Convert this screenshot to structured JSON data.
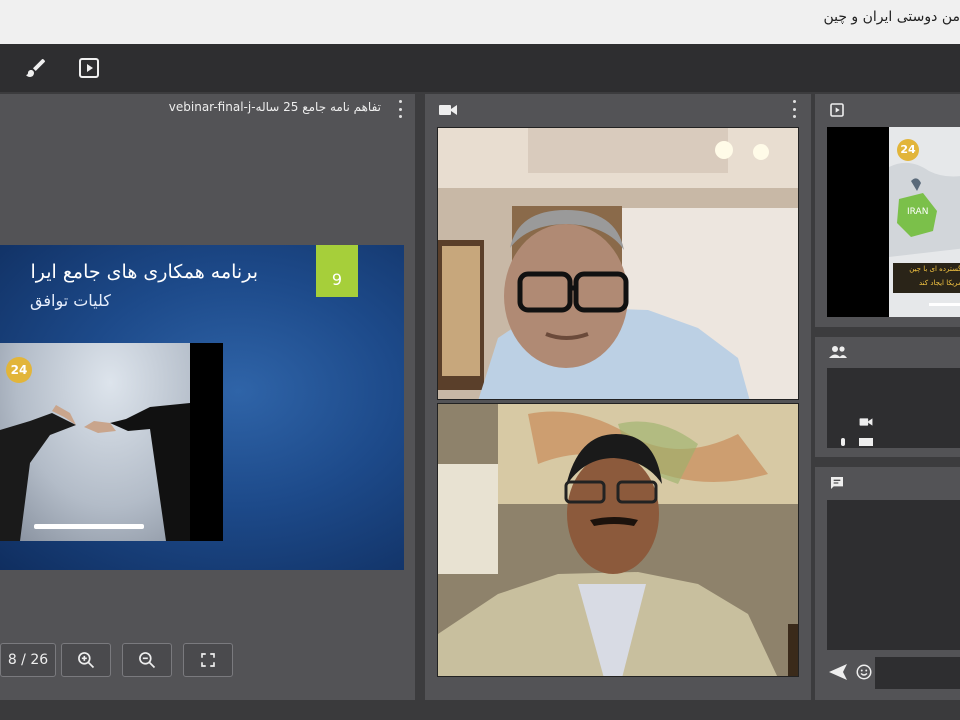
{
  "window": {
    "title": "من دوستی ایران و چین"
  },
  "toolbar": {
    "tools": [
      {
        "id": "brush",
        "icon": "brush-icon"
      },
      {
        "id": "play",
        "icon": "play-box-icon"
      }
    ]
  },
  "share_pod": {
    "document_title": "تفاهم نامه جامع 25 ساله-vebinar-final-j",
    "slide": {
      "number": "9",
      "title": "برنامه همکاری های جامع ایرا",
      "subtitle": "کلیات توافق",
      "logo_text": "24"
    },
    "controls": {
      "page_indicator": "8 / 26",
      "zoom_in_icon": "zoom-in-icon",
      "zoom_out_icon": "zoom-out-icon",
      "fullscreen_icon": "fullscreen-icon"
    }
  },
  "video_pod": {
    "header_icon": "camera-icon",
    "participants": [
      {
        "id": "video-1",
        "desc": "participant-1"
      },
      {
        "id": "video-2",
        "desc": "participant-2"
      }
    ]
  },
  "share_mini": {
    "header_icon": "play-box-icon",
    "logo_text": "24",
    "map_label": "IRAN",
    "caption_line1": "بلاد گسترده ای با چین",
    "caption_line2": "آل آمریکا ایجاد کند"
  },
  "attendees_pod": {
    "header_icon": "people-icon"
  },
  "chat_pod": {
    "header_icon": "chat-icon",
    "send_icon": "send-icon",
    "emoji_icon": "emoji-icon"
  },
  "colors": {
    "pod_bg": "#535356",
    "toolbar_bg": "#2e2e30",
    "slide_accent": "#a6cf3a",
    "slide_bg": "#1d4a8a"
  }
}
